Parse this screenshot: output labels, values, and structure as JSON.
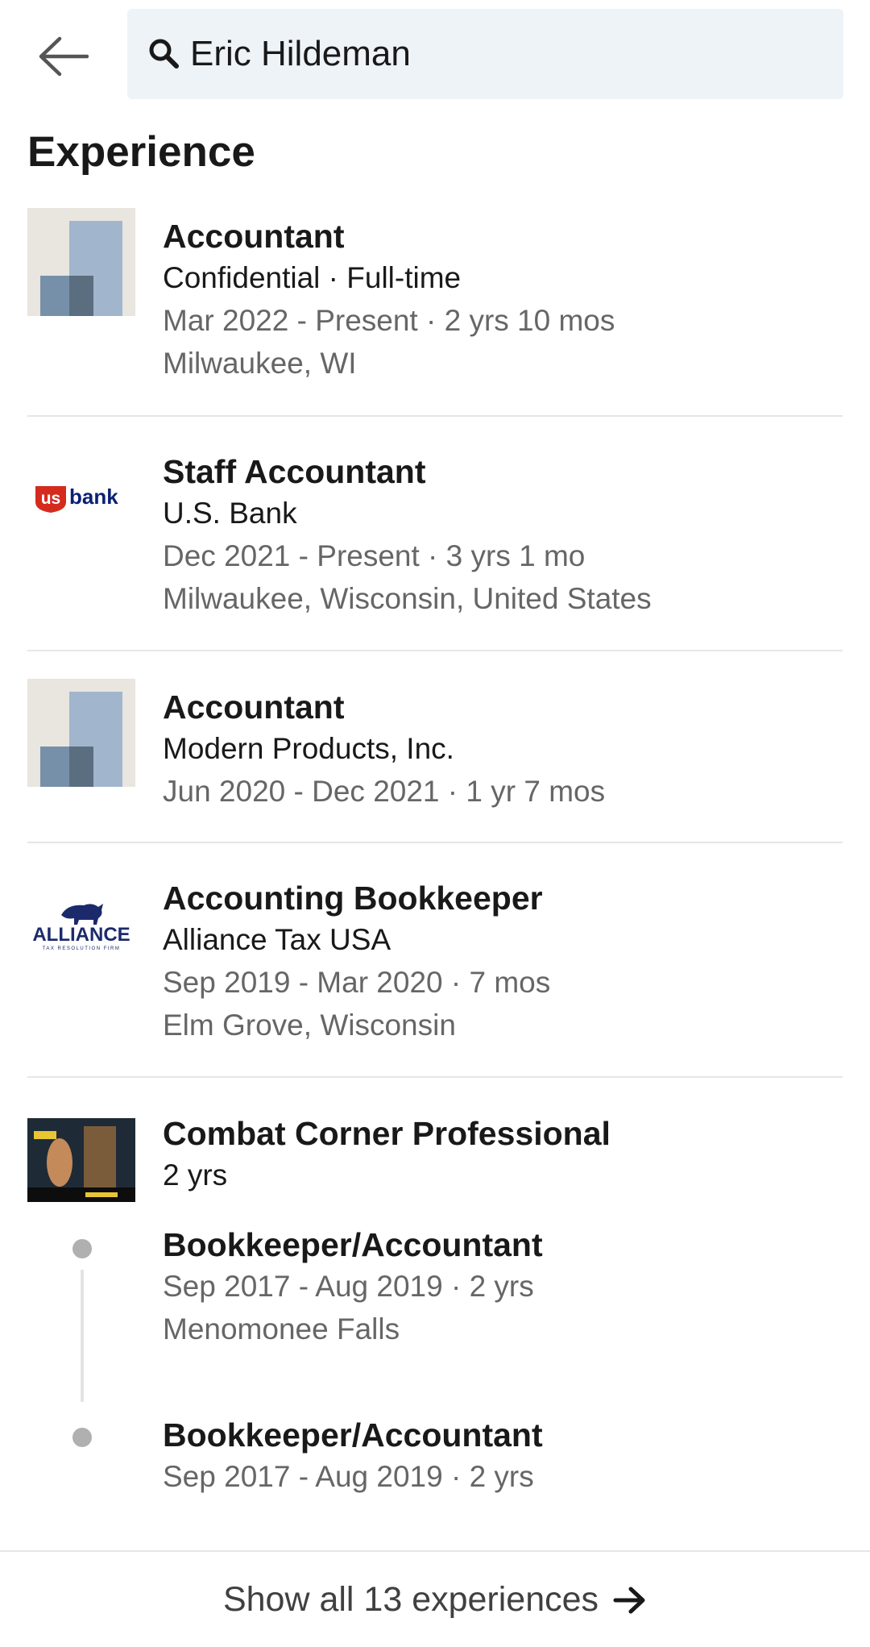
{
  "search": {
    "query": "Eric Hildeman"
  },
  "section": {
    "title": "Experience"
  },
  "experiences": [
    {
      "title": "Accountant",
      "company": "Confidential · Full-time",
      "dates": "Mar 2022 - Present · 2 yrs 10 mos",
      "location": "Milwaukee, WI",
      "logo": "placeholder-company-icon"
    },
    {
      "title": "Staff Accountant",
      "company": "U.S. Bank",
      "dates": "Dec 2021 - Present · 3 yrs 1 mo",
      "location": "Milwaukee, Wisconsin, United States",
      "logo": "usbank-logo",
      "logo_text_us": "us",
      "logo_text_bank": "bank"
    },
    {
      "title": "Accountant",
      "company": "Modern Products, Inc.",
      "dates": "Jun 2020 - Dec 2021 · 1 yr 7 mos",
      "logo": "placeholder-company-icon"
    },
    {
      "title": "Accounting Bookkeeper",
      "company": "Alliance Tax USA",
      "dates": "Sep 2019 - Mar 2020 · 7 mos",
      "location": "Elm Grove, Wisconsin",
      "logo": "alliance-logo",
      "logo_text": "ALLIANCE",
      "logo_tagline": "TAX RESOLUTION FIRM"
    },
    {
      "title": "Combat Corner Professional",
      "duration": "2 yrs",
      "logo": "combat-corner-logo",
      "roles": [
        {
          "title": "Bookkeeper/Accountant",
          "dates": "Sep 2017 - Aug 2019 · 2 yrs",
          "location": "Menomonee Falls"
        },
        {
          "title": "Bookkeeper/Accountant",
          "dates": "Sep 2017 - Aug 2019 · 2 yrs"
        }
      ]
    }
  ],
  "footer": {
    "show_all_label": "Show all 13 experiences"
  },
  "colors": {
    "usbank_red": "#d52b1e",
    "usbank_navy": "#0c2074",
    "alliance_navy": "#1b2a6b"
  }
}
